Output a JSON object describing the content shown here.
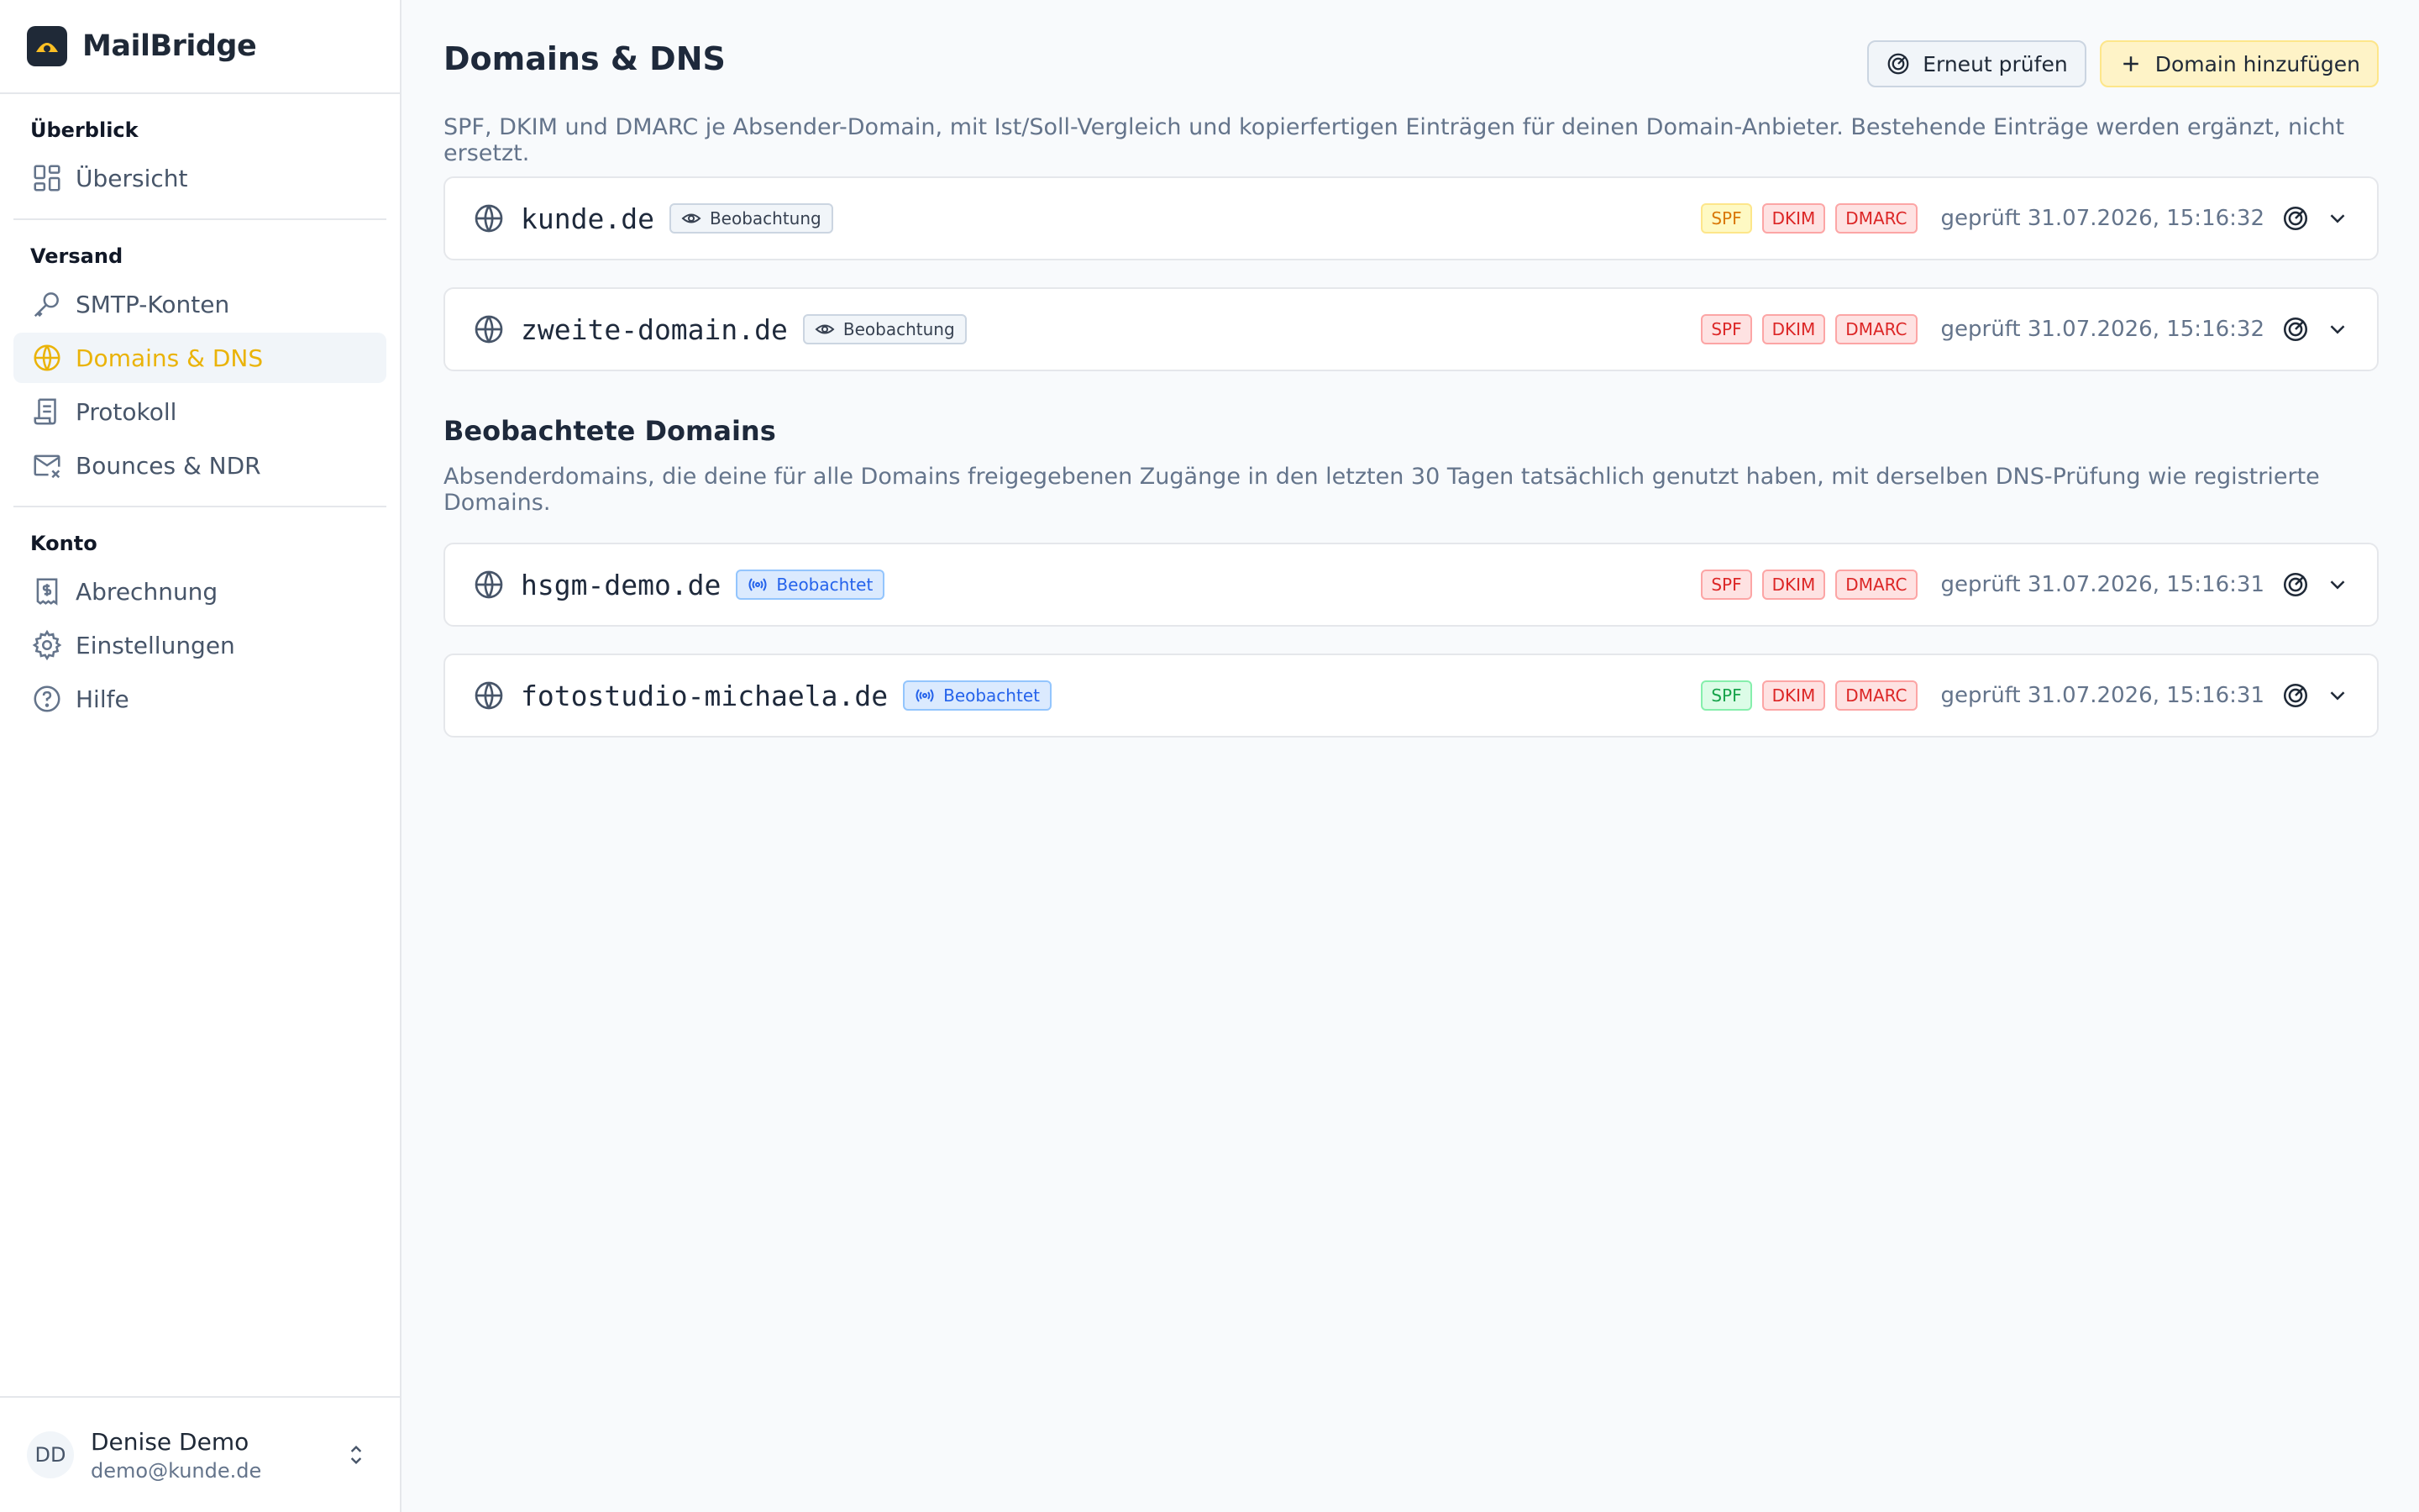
{
  "brand": {
    "name": "MailBridge"
  },
  "sidebar": {
    "sections": [
      {
        "title": "Überblick",
        "items": [
          {
            "label": "Übersicht",
            "icon": "dashboard-icon"
          }
        ]
      },
      {
        "title": "Versand",
        "items": [
          {
            "label": "SMTP-Konten",
            "icon": "key-icon"
          },
          {
            "label": "Domains & DNS",
            "icon": "globe-icon",
            "active": true
          },
          {
            "label": "Protokoll",
            "icon": "scroll-icon"
          },
          {
            "label": "Bounces & NDR",
            "icon": "mail-x-icon"
          }
        ]
      },
      {
        "title": "Konto",
        "items": [
          {
            "label": "Abrechnung",
            "icon": "receipt-dollar-icon"
          },
          {
            "label": "Einstellungen",
            "icon": "gear-icon"
          },
          {
            "label": "Hilfe",
            "icon": "help-circle-icon"
          }
        ]
      }
    ]
  },
  "user": {
    "initials": "DD",
    "name": "Denise Demo",
    "email": "demo@kunde.de"
  },
  "header": {
    "title": "Domains & DNS",
    "recheck_label": "Erneut prüfen",
    "add_label": "Domain hinzufügen",
    "subtitle": "SPF, DKIM und DMARC je Absender-Domain, mit Ist/Soll-Vergleich und kopierfertigen Einträgen für deinen Domain-Anbieter. Bestehende Einträge werden ergänzt, nicht ersetzt."
  },
  "domains": [
    {
      "name": "kunde.de",
      "tag": "Beobachtung",
      "spf": "warn",
      "dkim": "error",
      "dmarc": "error",
      "checked": "geprüft 31.07.2026, 15:16:32"
    },
    {
      "name": "zweite-domain.de",
      "tag": "Beobachtung",
      "spf": "error",
      "dkim": "error",
      "dmarc": "error",
      "checked": "geprüft 31.07.2026, 15:16:32"
    }
  ],
  "observed": {
    "title": "Beobachtete Domains",
    "description": "Absenderdomains, die deine für alle Domains freigegebenen Zugänge in den letzten 30 Tagen tatsächlich genutzt haben, mit derselben DNS-Prüfung wie registrierte Domains.",
    "items": [
      {
        "name": "hsgm-demo.de",
        "tag": "Beobachtet",
        "spf": "error",
        "dkim": "error",
        "dmarc": "error",
        "checked": "geprüft 31.07.2026, 15:16:31"
      },
      {
        "name": "fotostudio-michaela.de",
        "tag": "Beobachtet",
        "spf": "ok",
        "dkim": "error",
        "dmarc": "error",
        "checked": "geprüft 31.07.2026, 15:16:31"
      }
    ]
  },
  "badges": {
    "spf": "SPF",
    "dkim": "DKIM",
    "dmarc": "DMARC"
  },
  "colors": {
    "accent": "#eab308",
    "error": "#dc2626",
    "warn": "#d97706",
    "ok": "#16a34a",
    "observed": "#2563eb"
  }
}
